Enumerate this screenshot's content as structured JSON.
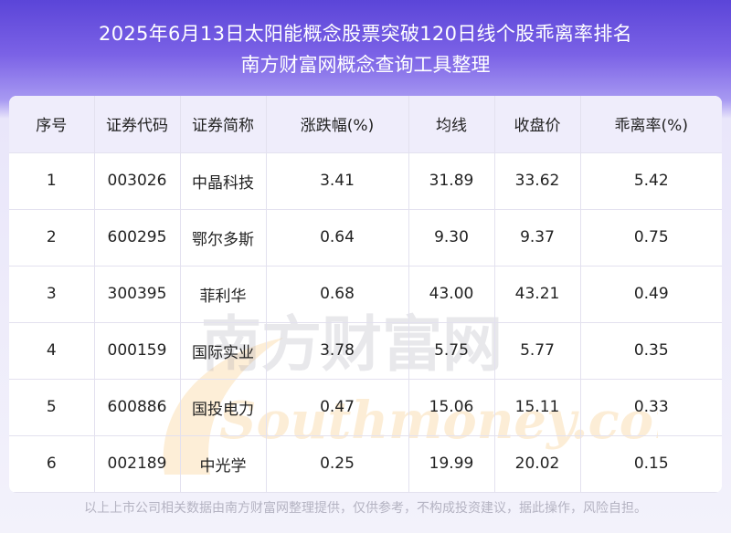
{
  "header": {
    "title": "2025年6月13日太阳能概念股票突破120日线个股乖离率排名",
    "subtitle": "南方财富网概念查询工具整理"
  },
  "table": {
    "columns": [
      "序号",
      "证券代码",
      "证券简称",
      "涨跌幅(%)",
      "均线",
      "收盘价",
      "乖离率(%)"
    ],
    "rows": [
      [
        "1",
        "003026",
        "中晶科技",
        "3.41",
        "31.89",
        "33.62",
        "5.42"
      ],
      [
        "2",
        "600295",
        "鄂尔多斯",
        "0.64",
        "9.30",
        "9.37",
        "0.75"
      ],
      [
        "3",
        "300395",
        "菲利华",
        "0.68",
        "43.00",
        "43.21",
        "0.49"
      ],
      [
        "4",
        "000159",
        "国际实业",
        "3.78",
        "5.75",
        "5.77",
        "0.35"
      ],
      [
        "5",
        "600886",
        "国投电力",
        "0.47",
        "15.06",
        "15.11",
        "0.33"
      ],
      [
        "6",
        "002189",
        "中光学",
        "0.25",
        "19.99",
        "20.02",
        "0.15"
      ]
    ]
  },
  "watermark": {
    "cn": "南方财富网",
    "en": "Southmoney.com"
  },
  "footer": {
    "disclaimer": "以上上市公司相关数据由南方财富网整理提供，仅供参考，不构成投资建议，据此操作，风险自担。"
  },
  "colors": {
    "header_gradient_top": "#5b45d8",
    "table_header_bg": "#efedfb",
    "watermark_orange": "#f5b24a"
  }
}
